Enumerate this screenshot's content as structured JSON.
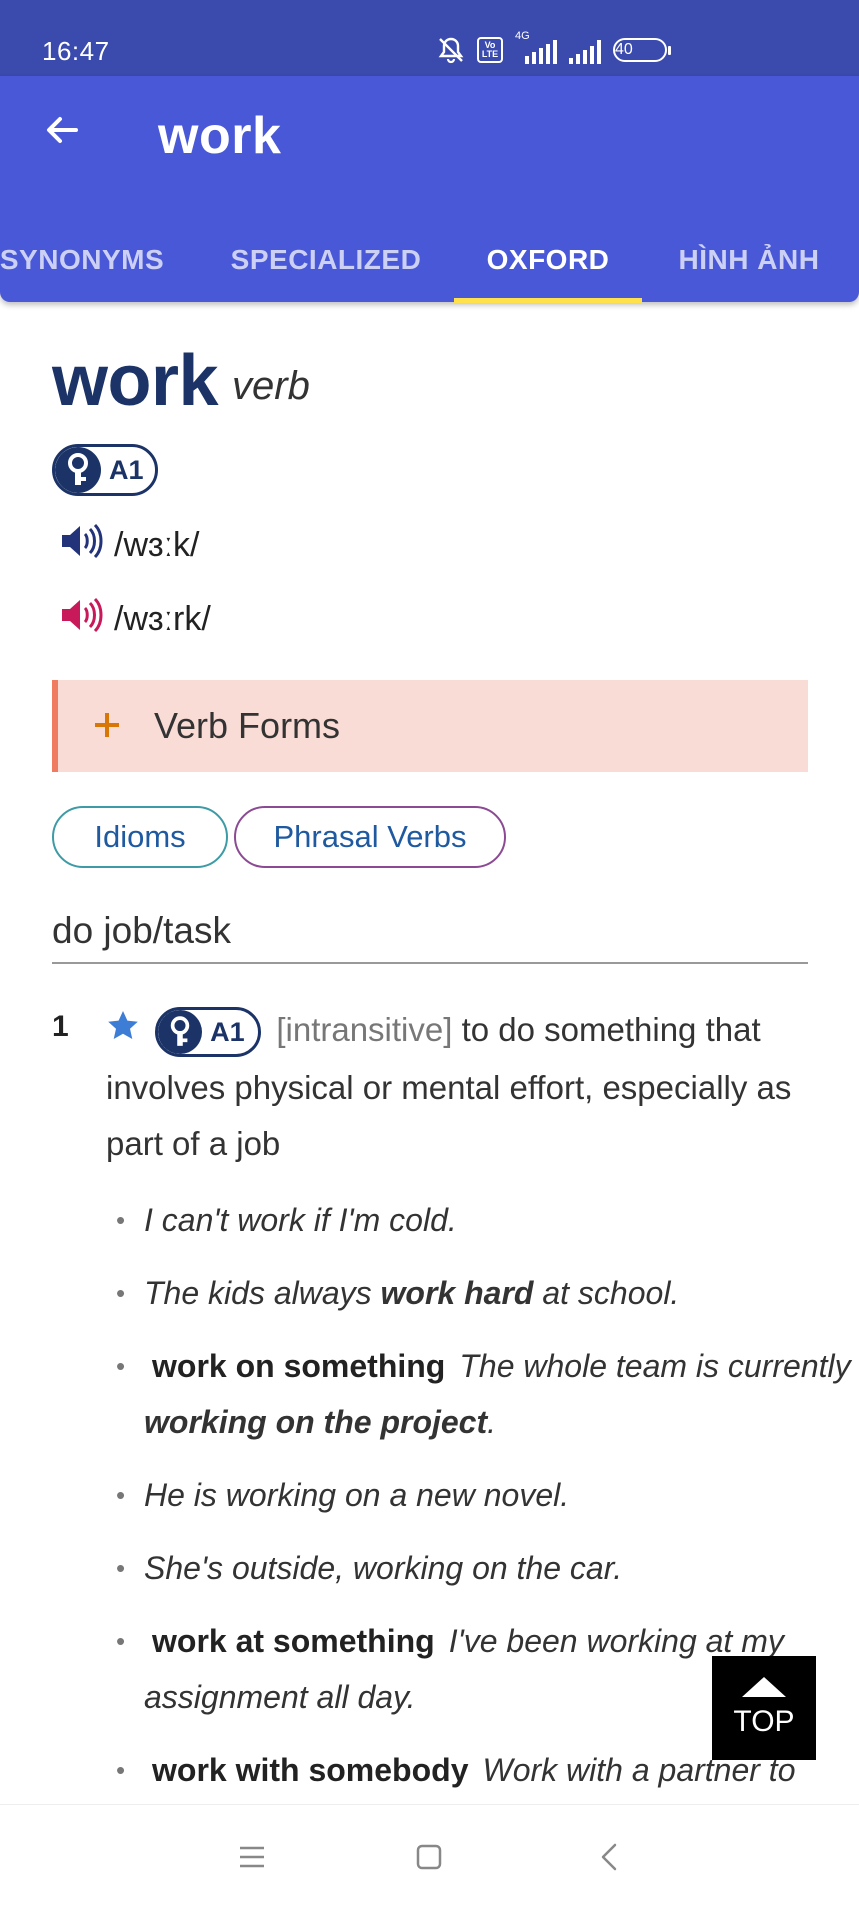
{
  "status_bar": {
    "time": "16:47",
    "network": "4G",
    "volte": "Vo LTE",
    "battery": "40",
    "icons": [
      "mute-bell-icon",
      "volte-icon",
      "signal-4g-icon",
      "signal-icon",
      "battery-icon"
    ]
  },
  "app_bar": {
    "title": "work",
    "back_icon": "arrow-left-icon",
    "tabs": [
      {
        "label": "SYNONYMS",
        "active": false
      },
      {
        "label": "SPECIALIZED",
        "active": false
      },
      {
        "label": "OXFORD",
        "active": true
      },
      {
        "label": "HÌNH ẢNH",
        "active": false
      }
    ],
    "colors": {
      "status_bar": "#3a4aad",
      "app_bar": "#4958d6",
      "indicator": "#ffe14d"
    }
  },
  "entry": {
    "headword": "work",
    "pos": "verb",
    "level": "A1",
    "pron_br": "/wɜːk/",
    "pron_am": "/wɜːrk/",
    "verb_forms_label": "Verb Forms",
    "chips": {
      "idioms": "Idioms",
      "phrasal": "Phrasal Verbs"
    },
    "sense_heading": "do job/task",
    "sense": {
      "number": "1",
      "level": "A1",
      "grammar": "[intransitive]",
      "definition": "to do something that involves physical or mental effort, especially as part of a job",
      "examples": {
        "e1": "I can't work if I'm cold.",
        "e2_pre": "The kids always ",
        "e2_bold": "work hard",
        "e2_post": " at school.",
        "e3_pattern": "work on something",
        "e3_pre": "The whole team is currently ",
        "e3_bold": "working on the project",
        "e3_post": ".",
        "e4": "He is working on a new novel.",
        "e5": "She's outside, working on the car.",
        "e6_pattern": "work at something",
        "e6_text": "I've been working at my assignment all day.",
        "e7_pattern": "work with somebody",
        "e7_text": "Work with a partner to"
      }
    }
  },
  "top_button": {
    "label": "TOP"
  },
  "nav_bar": {
    "icons": [
      "menu-icon",
      "home-square-icon",
      "back-chevron-icon"
    ]
  }
}
